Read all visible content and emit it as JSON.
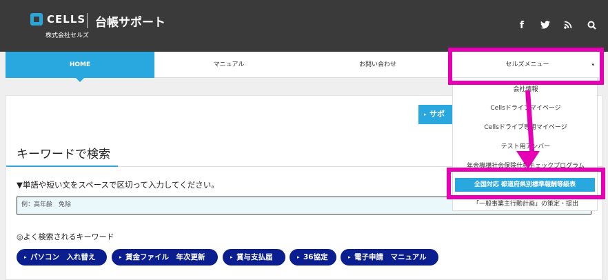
{
  "header": {
    "logo_text": "CELLS",
    "title": "台帳サポート",
    "company": "株式会社セルズ",
    "social": [
      {
        "icon": "facebook-icon",
        "glyph": "f"
      },
      {
        "icon": "twitter-icon",
        "glyph": "🐦"
      },
      {
        "icon": "rss-icon",
        "glyph": "))"
      },
      {
        "icon": "search-icon",
        "glyph": "🔍"
      }
    ]
  },
  "nav": {
    "items": [
      "HOME",
      "マニュアル",
      "お問い合わせ",
      "セルズメニュー"
    ],
    "caret": "▾"
  },
  "main": {
    "support_button": "サポ",
    "keyword_heading": "キーワードで検索",
    "instruction": "▼単語や短い文をスペースで区切って入力してください。",
    "search_placeholder": "例：高年齢　免除",
    "popular_label": "◎よく検索されるキーワード",
    "tags": [
      "パソコン　入れ替え",
      "賃金ファイル　年次更新",
      "賞与支払届",
      "36協定",
      "電子申請　マニュアル"
    ]
  },
  "dropdown": {
    "items": [
      "会社情報",
      "Cellsドライブマイページ",
      "Cellsドライブ専用マイページ",
      "テスト用アンバー",
      "年金機構社会保険仕様チェックプログラム",
      "全国対応 都道府県別標準報酬等級表",
      "「一般事業主行動計画」の策定・提出"
    ]
  },
  "colors": {
    "header_bg": "#3a3a3a",
    "accent": "#29a8e0",
    "tag_bg": "#0b1e8f",
    "annotation": "#e600b4"
  }
}
